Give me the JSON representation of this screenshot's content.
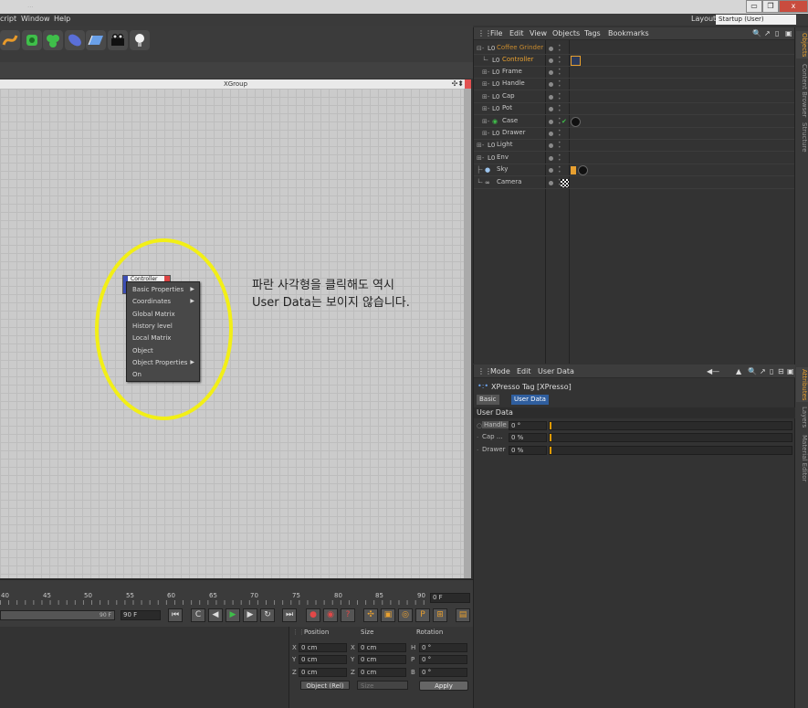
{
  "window": {
    "title_faded": "...",
    "buttons": {
      "minimize": "▭",
      "maximize": "❐",
      "close": "x"
    }
  },
  "menubar": {
    "items": [
      "cript",
      "Window",
      "Help"
    ],
    "layout_label": "Layout:",
    "layout_value": "Startup (User)"
  },
  "editor": {
    "title": "XGroup",
    "node_label": "Controller"
  },
  "context_menu": {
    "items": [
      {
        "label": "Basic Properties",
        "submenu": true
      },
      {
        "label": "Coordinates",
        "submenu": true
      },
      {
        "label": "Global Matrix",
        "submenu": false
      },
      {
        "label": "History level",
        "submenu": false
      },
      {
        "label": "Local Matrix",
        "submenu": false
      },
      {
        "label": "Object",
        "submenu": false
      },
      {
        "label": "Object Properties",
        "submenu": true
      },
      {
        "label": "On",
        "submenu": false
      }
    ]
  },
  "annotation": {
    "line1": "파란 사각형을 클릭해도 역시",
    "line2": "User Data는 보이지 않습니다."
  },
  "objects_panel": {
    "menu": [
      "File",
      "Edit",
      "View",
      "Objects",
      "Tags",
      "Bookmarks"
    ],
    "rows": [
      {
        "name": "Coffee Grinder",
        "color": "#c98b2e"
      },
      {
        "name": "Controller",
        "color": "#e8a030"
      },
      {
        "name": "Frame",
        "color": "#c8c8c8"
      },
      {
        "name": "Handle",
        "color": "#c8c8c8"
      },
      {
        "name": "Cap",
        "color": "#c8c8c8"
      },
      {
        "name": "Pot",
        "color": "#c8c8c8"
      },
      {
        "name": "Case",
        "color": "#c8c8c8"
      },
      {
        "name": "Drawer",
        "color": "#c8c8c8"
      },
      {
        "name": "Light",
        "color": "#c8c8c8"
      },
      {
        "name": "Env",
        "color": "#c8c8c8"
      },
      {
        "name": "Sky",
        "color": "#c8c8c8"
      },
      {
        "name": "Camera",
        "color": "#c8c8c8"
      }
    ]
  },
  "side_tabs": {
    "top": [
      "Objects",
      "Content Browser",
      "Structure"
    ],
    "bottom": [
      "Attributes",
      "Layers",
      "Material Editor"
    ]
  },
  "attributes_panel": {
    "menu": [
      "Mode",
      "Edit",
      "User Data"
    ],
    "title": "XPresso Tag [XPresso]",
    "tabs": [
      "Basic",
      "User Data"
    ],
    "section": "User Data",
    "rows": [
      {
        "label": "Handle",
        "value": "0 °",
        "slider": 0
      },
      {
        "label": "Cap ...",
        "value": "0 %",
        "slider": 0
      },
      {
        "label": "Drawer",
        "value": "0 %",
        "slider": 0
      }
    ]
  },
  "timeline": {
    "ticks": [
      "40",
      "45",
      "50",
      "55",
      "60",
      "65",
      "70",
      "75",
      "80",
      "85",
      "90"
    ],
    "current_frame": "0 F"
  },
  "transport": {
    "bar_value": "90 F",
    "end_frame": "90 F"
  },
  "coords": {
    "headers": [
      "Position",
      "Size",
      "Rotation"
    ],
    "rows": [
      {
        "axis": "X",
        "pos": "0 cm",
        "saxis": "X",
        "size": "0 cm",
        "raxis": "H",
        "rot": "0 °"
      },
      {
        "axis": "Y",
        "pos": "0 cm",
        "saxis": "Y",
        "size": "0 cm",
        "raxis": "P",
        "rot": "0 °"
      },
      {
        "axis": "Z",
        "pos": "0 cm",
        "saxis": "Z",
        "size": "0 cm",
        "raxis": "B",
        "rot": "0 °"
      }
    ],
    "mode": "Object (Rel)",
    "size_mode": "Size",
    "apply": "Apply"
  }
}
